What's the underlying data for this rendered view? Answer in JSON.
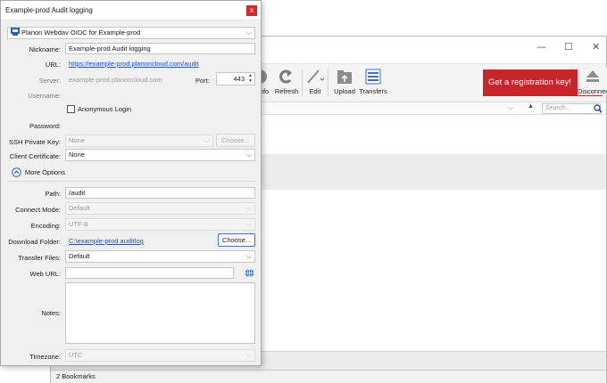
{
  "main_window": {
    "controls": {
      "minimize": "—",
      "maximize": "☐",
      "close": "✕"
    },
    "toolbar": {
      "info_label": "nfo",
      "refresh_label": "Refresh",
      "edit_label": "Edit",
      "upload_label": "Upload",
      "transfers_label": "Transfers",
      "registration_label": "Get a registration key!",
      "disconnect_label": "Disconnect"
    },
    "search": {
      "placeholder": "Search..."
    },
    "status_bar": {
      "text": "2 Bookmarks"
    },
    "colors": {
      "registration_bg": "#c6252a"
    }
  },
  "dialog": {
    "title": "Example-prod Audit logging",
    "close_glyph": "x",
    "protocol": "Planon Webdav OIDC for Example-prod",
    "nickname": {
      "label": "Nickname:",
      "value": "Example-prod Audit logging"
    },
    "url": {
      "label": "URL:",
      "value": "https://example-prod.planoncloud.com/audit"
    },
    "server": {
      "label": "Server:",
      "value": "example-prod.planoncloud.com"
    },
    "port": {
      "label": "Port:",
      "value": "443"
    },
    "username": {
      "label": "Username:",
      "value": ""
    },
    "anonymous_login": {
      "label": "Anonymous Login",
      "checked": false
    },
    "password": {
      "label": "Password:",
      "value": ""
    },
    "ssh_private_key": {
      "label": "SSH Private Key:",
      "value": "None",
      "choose_label": "Choose..."
    },
    "client_certificate": {
      "label": "Client Certificate:",
      "value": "None"
    },
    "more_options_label": "More Options",
    "path": {
      "label": "Path:",
      "value": "/audit"
    },
    "connect_mode": {
      "label": "Connect Mode:",
      "value": "Default"
    },
    "encoding": {
      "label": "Encoding:",
      "value": "UTF-8"
    },
    "download_folder": {
      "label": "Download Folder:",
      "value": "C:\\example-prod auditlog",
      "choose_label": "Choose..."
    },
    "transfer_files": {
      "label": "Transfer Files:",
      "value": "Default"
    },
    "web_url": {
      "label": "Web URL:",
      "value": ""
    },
    "notes": {
      "label": "Notes:",
      "value": ""
    },
    "timezone": {
      "label": "Timezone:",
      "value": "UTC"
    },
    "colors": {
      "close_bg": "#d9262c",
      "link": "#1a4fd0"
    },
    "icons": {
      "protocol": "server-icon",
      "more_options": "chevron-up-circle-icon",
      "web_url": "globe-icon",
      "dropdown": "chevron-down-icon"
    }
  }
}
